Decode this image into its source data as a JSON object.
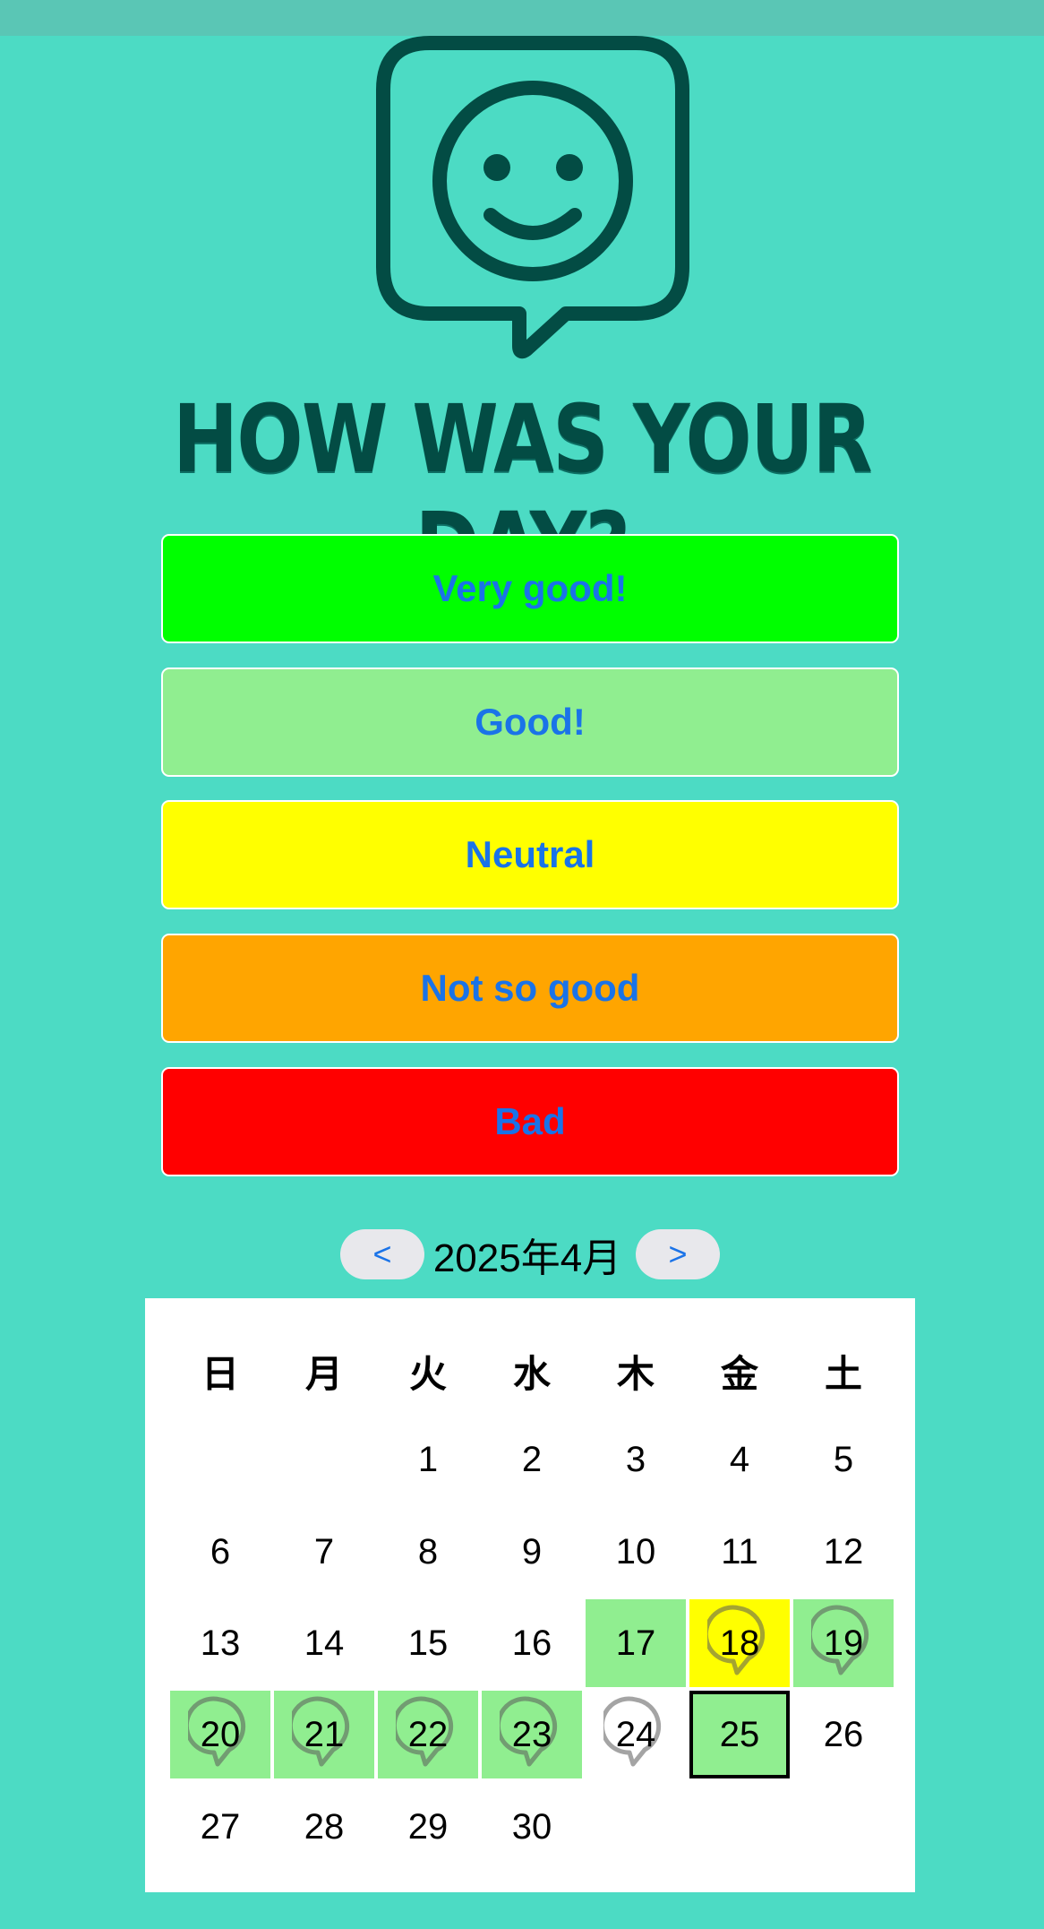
{
  "header": {
    "title": "HOW WAS YOUR DAY?",
    "logo_icon": "smiley-speech-bubble-icon"
  },
  "moods": [
    {
      "label": "Very good!",
      "color": "#00ff00"
    },
    {
      "label": "Good!",
      "color": "#90ee90"
    },
    {
      "label": "Neutral",
      "color": "#ffff00"
    },
    {
      "label": "Not so good",
      "color": "#ffa500"
    },
    {
      "label": "Bad",
      "color": "#ff0000"
    }
  ],
  "calendar": {
    "month_label": "2025年4月",
    "prev_label": "<",
    "next_label": ">",
    "weekdays": [
      "日",
      "月",
      "火",
      "水",
      "木",
      "金",
      "土"
    ],
    "days": [
      "",
      "",
      "1",
      "2",
      "3",
      "4",
      "5",
      "6",
      "7",
      "8",
      "9",
      "10",
      "11",
      "12",
      "13",
      "14",
      "15",
      "16",
      "17",
      "18",
      "19",
      "20",
      "21",
      "22",
      "23",
      "24",
      "25",
      "26",
      "27",
      "28",
      "29",
      "30",
      "",
      "",
      ""
    ],
    "entries": {
      "17": {
        "mood": "Good!",
        "note": false
      },
      "18": {
        "mood": "Neutral",
        "note": true
      },
      "19": {
        "mood": "Good!",
        "note": true
      },
      "20": {
        "mood": "Good!",
        "note": true
      },
      "21": {
        "mood": "Good!",
        "note": true
      },
      "22": {
        "mood": "Good!",
        "note": true
      },
      "23": {
        "mood": "Good!",
        "note": true
      },
      "24": {
        "mood": "",
        "note": true
      },
      "25": {
        "mood": "Good!",
        "note": false
      }
    },
    "today": "25",
    "note_icon": "comment-bubble-icon"
  }
}
